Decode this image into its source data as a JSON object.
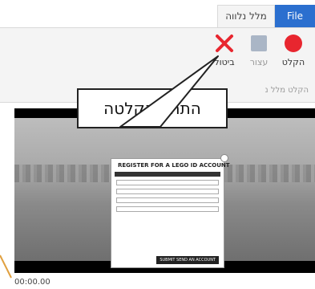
{
  "ribbon": {
    "tabs": [
      {
        "label": "File",
        "active": true
      },
      {
        "label": "מלל נלווה",
        "active": false
      }
    ],
    "buttons": {
      "record": "הקלט",
      "pause": "עצור",
      "cancel": "ביטול"
    },
    "group_label": "הקלט מלל נ",
    "accent_color": "#2b6fcf",
    "record_color": "#e8262f"
  },
  "callout": {
    "text": "התחל הקלטה"
  },
  "video": {
    "dialog": {
      "title": "REGISTER FOR A LEGO ID ACCOUNT",
      "submit": "SUBMIT SEND AN ACCOUNT"
    },
    "timecode": "00:00.00"
  }
}
